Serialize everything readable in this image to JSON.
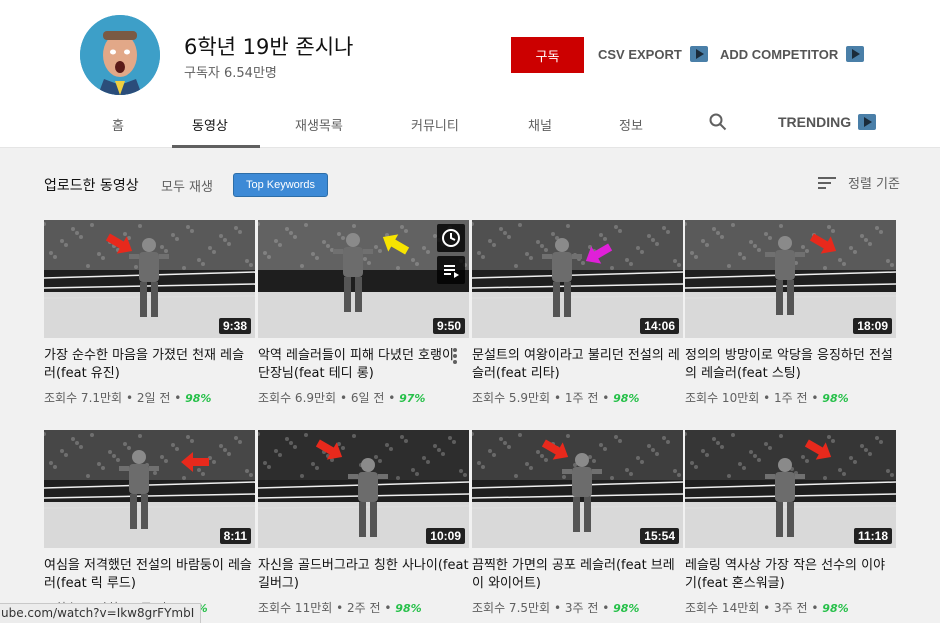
{
  "channel": {
    "name": "6학년 19반 존시나",
    "subscribers": "구독자 6.54만명",
    "subscribe_label": "구독"
  },
  "extensions": {
    "csv_export": "CSV EXPORT",
    "add_competitor": "ADD COMPETITOR"
  },
  "tabs": [
    {
      "label": "홈"
    },
    {
      "label": "동영상",
      "active": true
    },
    {
      "label": "재생목록"
    },
    {
      "label": "커뮤니티"
    },
    {
      "label": "채널"
    },
    {
      "label": "정보"
    },
    {
      "label": "TRENDING"
    }
  ],
  "section": {
    "title": "업로드한 동영상",
    "play_all": "모두 재생",
    "top_keywords": "Top Keywords",
    "sort": "정렬 기준"
  },
  "videos": [
    {
      "title": "가장 순수한 마음을 가졌던 천재 레슬러(feat 유진)",
      "views": "조회수 7.1만회",
      "age": "2일 전",
      "score": "98%",
      "duration": "9:38",
      "arrow_color": "#e8291c"
    },
    {
      "title": "악역 레슬러들이 피해 다녔던 호랭이 단장님(feat 테디 롱)",
      "views": "조회수 6.9만회",
      "age": "6일 전",
      "score": "97%",
      "duration": "9:50",
      "arrow_color": "#f7e400"
    },
    {
      "title": "문설트의 여왕이라고 불리던 전설의 레슬러(feat 리타)",
      "views": "조회수 5.9만회",
      "age": "1주 전",
      "score": "98%",
      "duration": "14:06",
      "arrow_color": "#e020d8"
    },
    {
      "title": "정의의 방망이로 악당을 응징하던 전설의 레슬러(feat 스팅)",
      "views": "조회수 10만회",
      "age": "1주 전",
      "score": "98%",
      "duration": "18:09",
      "arrow_color": "#e8291c"
    },
    {
      "title": "여심을 저격했던 전설의 바람둥이 레슬러(feat 릭 루드)",
      "views": "조회수 10만회",
      "age": "2주 전",
      "score": "98%",
      "duration": "8:11",
      "arrow_color": "#e8291c"
    },
    {
      "title": "자신을 골드버그라고 칭한 사나이(feat 길버그)",
      "views": "조회수 11만회",
      "age": "2주 전",
      "score": "98%",
      "duration": "10:09",
      "arrow_color": "#e8291c"
    },
    {
      "title": "끔찍한 가면의 공포 레슬러(feat 브레이 와이어트)",
      "views": "조회수 7.5만회",
      "age": "3주 전",
      "score": "98%",
      "duration": "15:54",
      "arrow_color": "#e8291c"
    },
    {
      "title": "레슬링 역사상 가장 작은 선수의 이야기(feat 혼스워글)",
      "views": "조회수 14만회",
      "age": "3주 전",
      "score": "98%",
      "duration": "11:18",
      "arrow_color": "#e8291c"
    }
  ],
  "status_url": "ube.com/watch?v=Ikw8grFYmbI",
  "colors": {
    "subscribe": "#cc0000",
    "top_keywords": "#3d8ad6",
    "score": "#27c04a"
  }
}
